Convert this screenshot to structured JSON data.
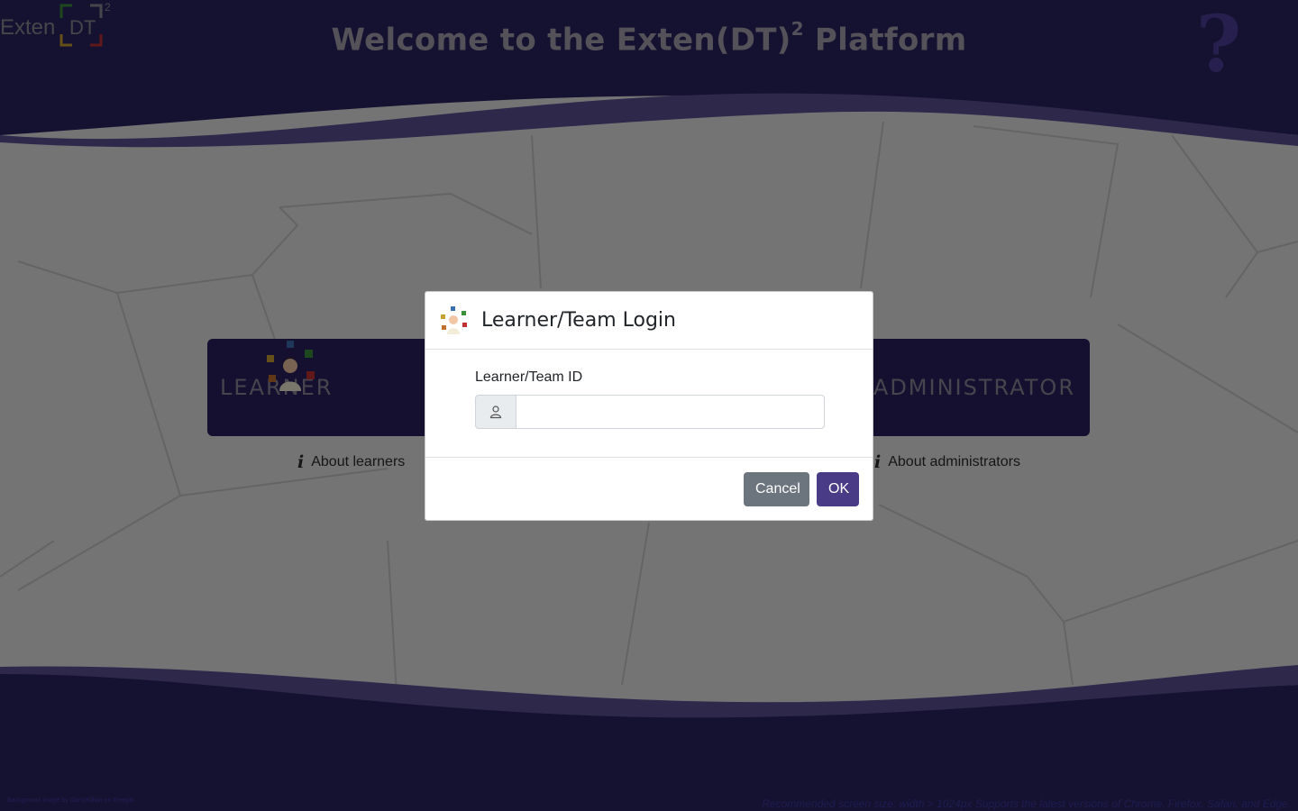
{
  "header": {
    "title_main": "Welcome to the Exten(DT)",
    "title_sup": "2",
    "title_end": " Platform"
  },
  "help": {
    "icon": "question-mark-icon",
    "glyph": "?"
  },
  "roles": {
    "learner": {
      "label": "LEARNER",
      "about": "About learners"
    },
    "admin": {
      "label": "ADMINISTRATOR",
      "about": "About administrators"
    }
  },
  "modal": {
    "title": "Learner/Team Login",
    "field_label": "Learner/Team ID",
    "field_value": "",
    "field_icon": "user-icon",
    "cancel_label": "Cancel",
    "ok_label": "OK"
  },
  "brand": {
    "logo_text": "Exten",
    "logo_dt": "DT",
    "logo_sup": "2",
    "credit": "Background image by GarryKillian on Freepik"
  },
  "footer": {
    "note": "Recommended screen size: width > 1024px Supports the latest versions of Chrome, Firefox, Safari, and Edge."
  },
  "colors": {
    "header_bg": "#2a2463",
    "wave": "#5d5096",
    "card_bg": "#2a2060",
    "ok_button": "#4a3b86",
    "cancel_button": "#6c757d"
  }
}
